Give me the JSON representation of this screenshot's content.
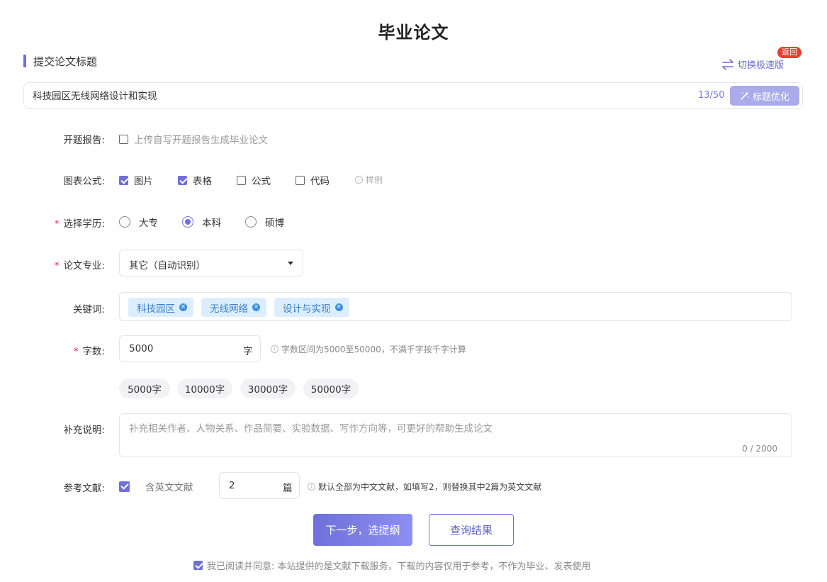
{
  "page_title": "毕业论文",
  "section_title": "提交论文标题",
  "switch_label": "切换极速版",
  "return_label": "返回",
  "title_input": {
    "value": "科技园区无线网络设计和实现",
    "count": "13/50",
    "optimize_label": "标题优化"
  },
  "proposal": {
    "label": "开题报告:",
    "option": "上传自写开题报告生成毕业论文"
  },
  "charts": {
    "label": "图表公式:",
    "options": [
      {
        "label": "图片",
        "checked": true
      },
      {
        "label": "表格",
        "checked": true
      },
      {
        "label": "公式",
        "checked": false
      },
      {
        "label": "代码",
        "checked": false
      }
    ],
    "sample_label": "样例"
  },
  "degree": {
    "required": "*",
    "label": "选择学历:",
    "options": [
      {
        "label": "大专",
        "selected": false
      },
      {
        "label": "本科",
        "selected": true
      },
      {
        "label": "硕博",
        "selected": false
      }
    ]
  },
  "major": {
    "required": "*",
    "label": "论文专业:",
    "value": "其它（自动识别）"
  },
  "keywords": {
    "label": "关键词:",
    "tags": [
      "科技园区",
      "无线网络",
      "设计与实现"
    ]
  },
  "word_count": {
    "required": "*",
    "label": "字数:",
    "value": "5000",
    "unit": "字",
    "hint": "字数区间为5000至50000，不满千字按千字计算",
    "presets": [
      "5000字",
      "10000字",
      "30000字",
      "50000字"
    ]
  },
  "notes": {
    "label": "补充说明:",
    "placeholder": "补充相关作者、人物关系、作品简要、实验数据、写作方向等，可更好的帮助生成论文",
    "count": "0 / 2000"
  },
  "references": {
    "label": "参考文献:",
    "english_label": "含英文文献",
    "value": "2",
    "unit": "篇",
    "hint": "默认全部为中文文献，如填写2，则替换其中2篇为英文文献"
  },
  "next_button": "下一步，选提纲",
  "query_button": "查询结果",
  "agreement": "我已阅读并同意: 本站提供的是文献下载服务，下载的内容仅用于参考，不作为毕业、发表使用",
  "colors": {
    "accent": "#6f70d9",
    "tag_bg": "#dceefe",
    "badge": "#f2392f"
  }
}
